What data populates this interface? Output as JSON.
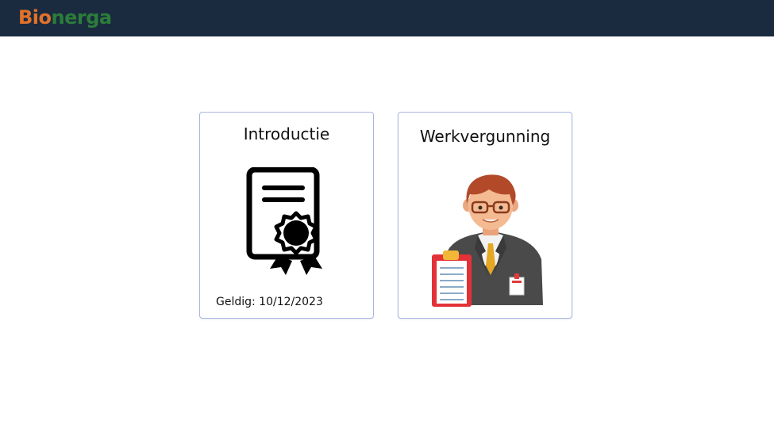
{
  "app": {
    "logo": {
      "part1": "Bi",
      "part2": "o",
      "part3": "nerga"
    }
  },
  "cards": [
    {
      "title": "Introductie",
      "icon": "certificate-icon",
      "footer": "Geldig: 10/12/2023"
    },
    {
      "title": "Werkvergunning",
      "icon": "inspector-with-clipboard-illustration"
    }
  ],
  "colors": {
    "topbar": "#1a2b40",
    "logo_orange": "#e2722a",
    "logo_green": "#2b7d3a",
    "card_border": "#a9b6e0"
  }
}
